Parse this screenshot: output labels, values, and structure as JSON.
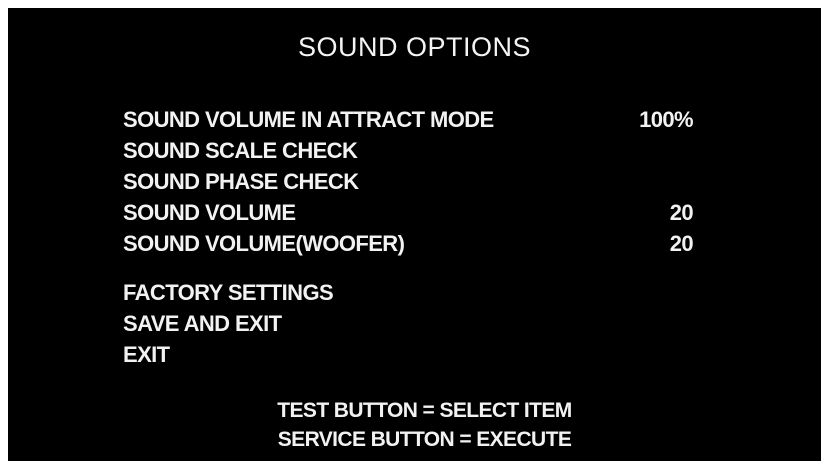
{
  "screen": {
    "title": "SOUND OPTIONS",
    "background": "#000000",
    "text_color": "#f2f2f2"
  },
  "menu": {
    "items": [
      {
        "label": "SOUND VOLUME IN ATTRACT MODE",
        "value": "100%"
      },
      {
        "label": "SOUND SCALE CHECK",
        "value": ""
      },
      {
        "label": "SOUND PHASE CHECK",
        "value": ""
      },
      {
        "label": "SOUND VOLUME",
        "value": "20"
      },
      {
        "label": "SOUND VOLUME(WOOFER)",
        "value": "20"
      }
    ],
    "actions": [
      {
        "label": "FACTORY SETTINGS"
      },
      {
        "label": "SAVE AND EXIT"
      },
      {
        "label": "EXIT"
      }
    ]
  },
  "footer": {
    "line1": "TEST BUTTON = SELECT ITEM",
    "line2": "SERVICE BUTTON = EXECUTE"
  }
}
